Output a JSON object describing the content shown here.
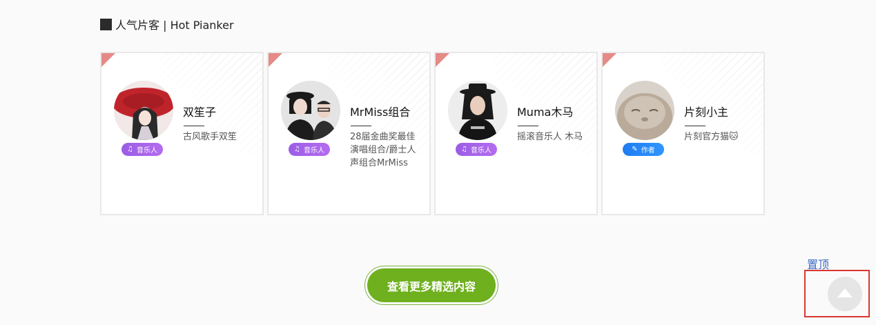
{
  "section": {
    "title": "人气片客 | Hot Pianker"
  },
  "cards": [
    {
      "name": "双笙子",
      "description": "古风歌手双笙",
      "badge": {
        "label": "音乐人",
        "icon": "music-note-icon"
      }
    },
    {
      "name": "MrMiss组合",
      "description": "28届金曲奖最佳演唱组合/爵士人声组合MrMiss",
      "badge": {
        "label": "音乐人",
        "icon": "music-note-icon"
      }
    },
    {
      "name": "Muma木马",
      "description": "摇滚音乐人 木马",
      "badge": {
        "label": "音乐人",
        "icon": "music-note-icon"
      }
    },
    {
      "name": "片刻小主",
      "description": "片刻官方猫🐱",
      "badge": {
        "label": "作者",
        "icon": "pen-icon"
      }
    }
  ],
  "more_button": {
    "label": "查看更多精选内容"
  },
  "back_to_top": {
    "label": "置顶"
  },
  "colors": {
    "accent_green": "#6fb01f",
    "music_badge": "#9b5de5",
    "author_badge": "#1e7cf2",
    "corner_flag": "#e58a86",
    "highlight": "#d9362f"
  }
}
